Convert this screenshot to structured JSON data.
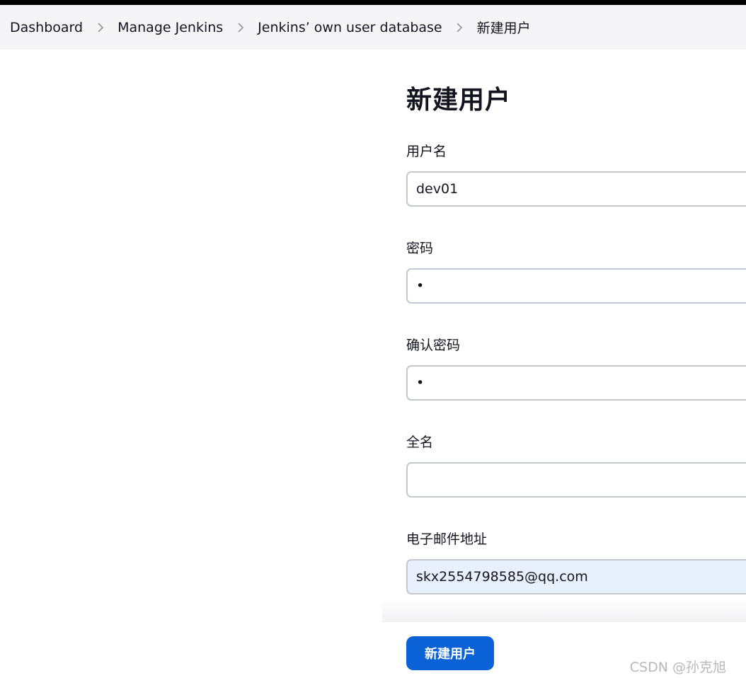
{
  "breadcrumb": {
    "items": [
      "Dashboard",
      "Manage Jenkins",
      "Jenkins’ own user database",
      "新建用户"
    ]
  },
  "page": {
    "title": "新建用户"
  },
  "form": {
    "username": {
      "label": "用户名",
      "value": "dev01"
    },
    "password": {
      "label": "密码",
      "value": "•"
    },
    "confirm_password": {
      "label": "确认密码",
      "value": "•"
    },
    "fullname": {
      "label": "全名",
      "value": ""
    },
    "email": {
      "label": "电子邮件地址",
      "value": "skx2554798585@qq.com"
    },
    "submit_label": "新建用户"
  },
  "watermark": "CSDN @孙克旭",
  "colors": {
    "accent": "#0a62d6",
    "autofill_bg": "#e8f0fe",
    "breadcrumb_bg": "#f5f5f7"
  }
}
